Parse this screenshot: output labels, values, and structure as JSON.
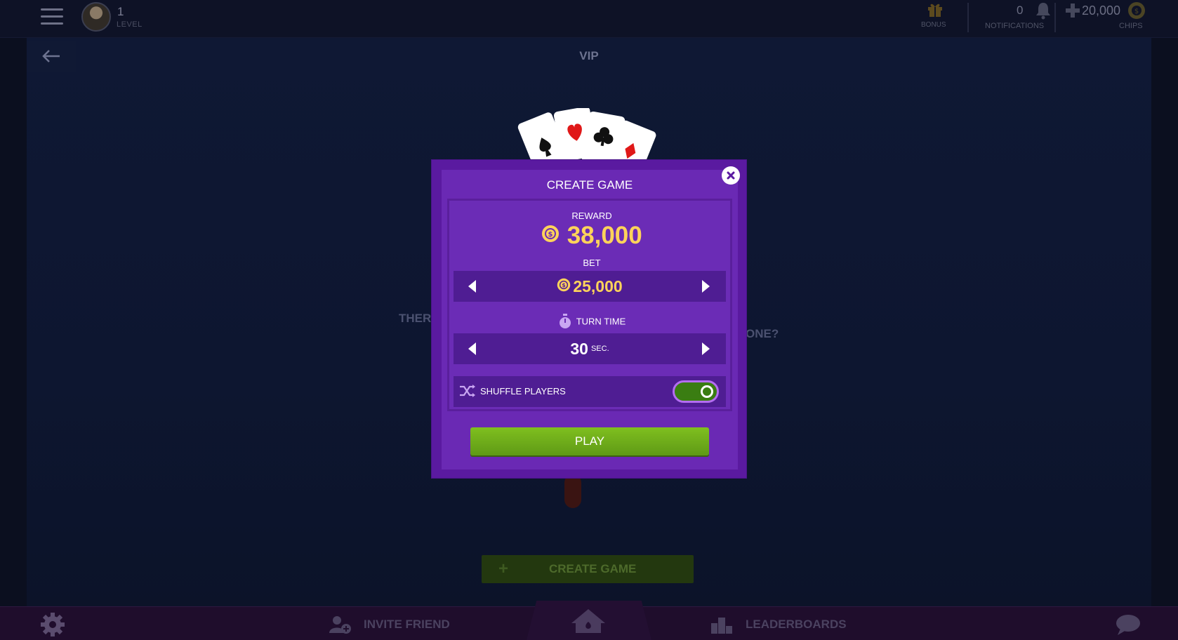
{
  "topbar": {
    "level": "1",
    "level_label": "LEVEL",
    "bonus_label": "BONUS",
    "notifications_count": "0",
    "notifications_label": "NOTIFICATIONS",
    "chips_amount": "20,000",
    "chips_label": "CHIPS"
  },
  "page": {
    "title": "VIP",
    "bg_text_left": "THER",
    "bg_text_right": "ONE?",
    "create_game_label": "CREATE GAME"
  },
  "modal": {
    "title": "CREATE GAME",
    "reward_label": "REWARD",
    "reward_value": "38,000",
    "bet_label": "BET",
    "bet_value": "25,000",
    "turn_time_label": "TURN TIME",
    "turn_time_value": "30",
    "turn_time_unit": "SEC.",
    "shuffle_label": "SHUFFLE PLAYERS",
    "shuffle_enabled": true,
    "play_label": "PLAY"
  },
  "bottombar": {
    "invite_label": "INVITE FRIEND",
    "leaderboards_label": "LEADERBOARDS"
  },
  "colors": {
    "modal_bg": "#5a1aa0",
    "panel_bg": "#6b2cb6",
    "stepper_bg": "#4f1d93",
    "gold": "#ffd35a",
    "play_green": "#6fad1a",
    "toggle_on": "#3a7d12"
  },
  "icons": [
    "hamburger-icon",
    "avatar",
    "gift-icon",
    "bell-icon",
    "plus-icon",
    "chip-icon",
    "back-arrow-icon",
    "close-icon",
    "chevron-left-icon",
    "chevron-right-icon",
    "stopwatch-icon",
    "shuffle-icon",
    "gear-icon",
    "invite-friend-icon",
    "home-icon",
    "leaderboard-icon",
    "chat-icon"
  ]
}
